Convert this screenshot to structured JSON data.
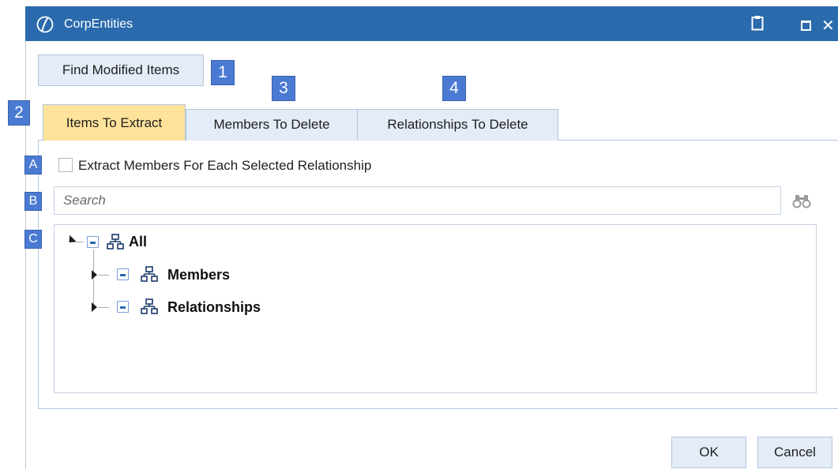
{
  "window": {
    "title": "CorpEntities",
    "titlebar_color": "#2a6aad",
    "icons": [
      "app-logo-icon",
      "clipboard-icon",
      "maximize-icon",
      "close-icon"
    ]
  },
  "toolbar": {
    "find_modified_label": "Find Modified Items"
  },
  "badges": {
    "b1": "1",
    "b2": "2",
    "b3": "3",
    "b4": "4",
    "bA": "A",
    "bB": "B",
    "bC": "C",
    "color": "#4a7ad2"
  },
  "tabs": [
    {
      "label": "Items To Extract",
      "active": true
    },
    {
      "label": "Members To Delete",
      "active": false
    },
    {
      "label": "Relationships To Delete",
      "active": false
    }
  ],
  "active_tab_color": "#ffe39a",
  "extract_option": {
    "label": "Extract Members For Each Selected Relationship",
    "checked": false
  },
  "search": {
    "placeholder": "Search",
    "icon": "binoculars-icon"
  },
  "tree": {
    "root": {
      "label": "All",
      "expanded": true,
      "state": "partial"
    },
    "children": [
      {
        "label": "Members",
        "expanded": false,
        "state": "partial"
      },
      {
        "label": "Relationships",
        "expanded": false,
        "state": "partial"
      }
    ]
  },
  "footer": {
    "ok_label": "OK",
    "cancel_label": "Cancel"
  }
}
